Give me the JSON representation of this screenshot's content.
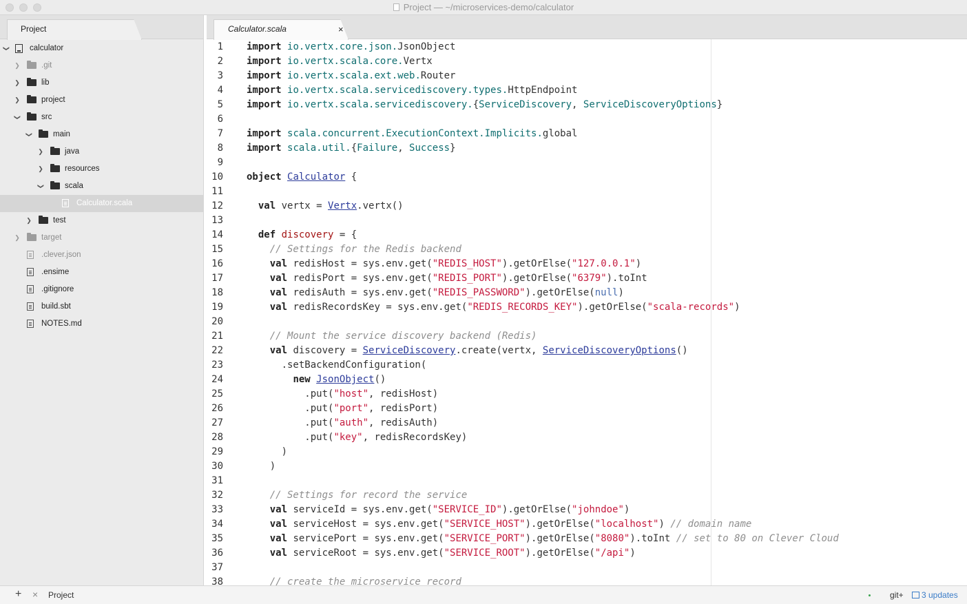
{
  "window": {
    "title": "Project — ~/microservices-demo/calculator"
  },
  "sidebar": {
    "tab_label": "Project",
    "tree": [
      {
        "label": "calculator",
        "type": "repo",
        "depth": 0,
        "chevron": "down",
        "dim": false
      },
      {
        "label": ".git",
        "type": "folder",
        "depth": 1,
        "chevron": "right",
        "dim": true
      },
      {
        "label": "lib",
        "type": "folder",
        "depth": 1,
        "chevron": "right",
        "dim": false
      },
      {
        "label": "project",
        "type": "folder",
        "depth": 1,
        "chevron": "right",
        "dim": false
      },
      {
        "label": "src",
        "type": "folder",
        "depth": 1,
        "chevron": "down",
        "dim": false
      },
      {
        "label": "main",
        "type": "folder",
        "depth": 2,
        "chevron": "down",
        "dim": false
      },
      {
        "label": "java",
        "type": "folder",
        "depth": 3,
        "chevron": "right",
        "dim": false
      },
      {
        "label": "resources",
        "type": "folder",
        "depth": 3,
        "chevron": "right",
        "dim": false
      },
      {
        "label": "scala",
        "type": "folder",
        "depth": 3,
        "chevron": "down",
        "dim": false
      },
      {
        "label": "Calculator.scala",
        "type": "file",
        "depth": 4,
        "chevron": "",
        "dim": false,
        "selected": true
      },
      {
        "label": "test",
        "type": "folder",
        "depth": 2,
        "chevron": "right",
        "dim": false
      },
      {
        "label": "target",
        "type": "folder",
        "depth": 1,
        "chevron": "right",
        "dim": true
      },
      {
        "label": ".clever.json",
        "type": "file",
        "depth": 1,
        "chevron": "",
        "dim": true
      },
      {
        "label": ".ensime",
        "type": "file",
        "depth": 1,
        "chevron": "",
        "dim": false
      },
      {
        "label": ".gitignore",
        "type": "file",
        "depth": 1,
        "chevron": "",
        "dim": false
      },
      {
        "label": "build.sbt",
        "type": "file",
        "depth": 1,
        "chevron": "",
        "dim": false
      },
      {
        "label": "NOTES.md",
        "type": "file",
        "depth": 1,
        "chevron": "",
        "dim": false
      }
    ]
  },
  "editor": {
    "tab_label": "Calculator.scala",
    "tab_close": "×",
    "lines": [
      [
        [
          "kw",
          "import"
        ],
        [
          "t",
          " "
        ],
        [
          "pkg",
          "io.vertx.core.json."
        ],
        [
          "t",
          "JsonObject"
        ]
      ],
      [
        [
          "kw",
          "import"
        ],
        [
          "t",
          " "
        ],
        [
          "pkg",
          "io.vertx.scala.core."
        ],
        [
          "t",
          "Vertx"
        ]
      ],
      [
        [
          "kw",
          "import"
        ],
        [
          "t",
          " "
        ],
        [
          "pkg",
          "io.vertx.scala.ext.web."
        ],
        [
          "t",
          "Router"
        ]
      ],
      [
        [
          "kw",
          "import"
        ],
        [
          "t",
          " "
        ],
        [
          "pkg",
          "io.vertx.scala.servicediscovery.types."
        ],
        [
          "t",
          "HttpEndpoint"
        ]
      ],
      [
        [
          "kw",
          "import"
        ],
        [
          "t",
          " "
        ],
        [
          "pkg",
          "io.vertx.scala.servicediscovery."
        ],
        [
          "t",
          "{"
        ],
        [
          "pkg",
          "ServiceDiscovery"
        ],
        [
          "t",
          ", "
        ],
        [
          "pkg",
          "ServiceDiscoveryOptions"
        ],
        [
          "t",
          "}"
        ]
      ],
      [],
      [
        [
          "kw",
          "import"
        ],
        [
          "t",
          " "
        ],
        [
          "pkg",
          "scala.concurrent.ExecutionContext.Implicits."
        ],
        [
          "t",
          "global"
        ]
      ],
      [
        [
          "kw",
          "import"
        ],
        [
          "t",
          " "
        ],
        [
          "pkg",
          "scala.util."
        ],
        [
          "t",
          "{"
        ],
        [
          "pkg",
          "Failure"
        ],
        [
          "t",
          ", "
        ],
        [
          "pkg",
          "Success"
        ],
        [
          "t",
          "}"
        ]
      ],
      [],
      [
        [
          "kw",
          "object"
        ],
        [
          "t",
          " "
        ],
        [
          "typ",
          "Calculator"
        ],
        [
          "t",
          " {"
        ]
      ],
      [],
      [
        [
          "t",
          "  "
        ],
        [
          "kw",
          "val"
        ],
        [
          "t",
          " vertx = "
        ],
        [
          "typ",
          "Vertx"
        ],
        [
          "t",
          ".vertx()"
        ]
      ],
      [],
      [
        [
          "t",
          "  "
        ],
        [
          "kw",
          "def"
        ],
        [
          "t",
          " "
        ],
        [
          "fn",
          "discovery"
        ],
        [
          "t",
          " = {"
        ]
      ],
      [
        [
          "t",
          "    "
        ],
        [
          "cmt",
          "// Settings for the Redis backend"
        ]
      ],
      [
        [
          "t",
          "    "
        ],
        [
          "kw",
          "val"
        ],
        [
          "t",
          " redisHost = sys.env.get("
        ],
        [
          "str",
          "\"REDIS_HOST\""
        ],
        [
          "t",
          ").getOrElse("
        ],
        [
          "str",
          "\"127.0.0.1\""
        ],
        [
          "t",
          ")"
        ]
      ],
      [
        [
          "t",
          "    "
        ],
        [
          "kw",
          "val"
        ],
        [
          "t",
          " redisPort = sys.env.get("
        ],
        [
          "str",
          "\"REDIS_PORT\""
        ],
        [
          "t",
          ").getOrElse("
        ],
        [
          "str",
          "\"6379\""
        ],
        [
          "t",
          ").toInt"
        ]
      ],
      [
        [
          "t",
          "    "
        ],
        [
          "kw",
          "val"
        ],
        [
          "t",
          " redisAuth = sys.env.get("
        ],
        [
          "str",
          "\"REDIS_PASSWORD\""
        ],
        [
          "t",
          ").getOrElse("
        ],
        [
          "nul",
          "null"
        ],
        [
          "t",
          ")"
        ]
      ],
      [
        [
          "t",
          "    "
        ],
        [
          "kw",
          "val"
        ],
        [
          "t",
          " redisRecordsKey = sys.env.get("
        ],
        [
          "str",
          "\"REDIS_RECORDS_KEY\""
        ],
        [
          "t",
          ").getOrElse("
        ],
        [
          "str",
          "\"scala-records\""
        ],
        [
          "t",
          ")"
        ]
      ],
      [],
      [
        [
          "t",
          "    "
        ],
        [
          "cmt",
          "// Mount the service discovery backend (Redis)"
        ]
      ],
      [
        [
          "t",
          "    "
        ],
        [
          "kw",
          "val"
        ],
        [
          "t",
          " discovery = "
        ],
        [
          "typ",
          "ServiceDiscovery"
        ],
        [
          "t",
          ".create(vertx, "
        ],
        [
          "typ",
          "ServiceDiscoveryOptions"
        ],
        [
          "t",
          "()"
        ]
      ],
      [
        [
          "t",
          "      .setBackendConfiguration("
        ]
      ],
      [
        [
          "t",
          "        "
        ],
        [
          "kw",
          "new"
        ],
        [
          "t",
          " "
        ],
        [
          "typ",
          "JsonObject"
        ],
        [
          "t",
          "()"
        ]
      ],
      [
        [
          "t",
          "          .put("
        ],
        [
          "str",
          "\"host\""
        ],
        [
          "t",
          ", redisHost)"
        ]
      ],
      [
        [
          "t",
          "          .put("
        ],
        [
          "str",
          "\"port\""
        ],
        [
          "t",
          ", redisPort)"
        ]
      ],
      [
        [
          "t",
          "          .put("
        ],
        [
          "str",
          "\"auth\""
        ],
        [
          "t",
          ", redisAuth)"
        ]
      ],
      [
        [
          "t",
          "          .put("
        ],
        [
          "str",
          "\"key\""
        ],
        [
          "t",
          ", redisRecordsKey)"
        ]
      ],
      [
        [
          "t",
          "      )"
        ]
      ],
      [
        [
          "t",
          "    )"
        ]
      ],
      [],
      [
        [
          "t",
          "    "
        ],
        [
          "cmt",
          "// Settings for record the service"
        ]
      ],
      [
        [
          "t",
          "    "
        ],
        [
          "kw",
          "val"
        ],
        [
          "t",
          " serviceId = sys.env.get("
        ],
        [
          "str",
          "\"SERVICE_ID\""
        ],
        [
          "t",
          ").getOrElse("
        ],
        [
          "str",
          "\"johndoe\""
        ],
        [
          "t",
          ")"
        ]
      ],
      [
        [
          "t",
          "    "
        ],
        [
          "kw",
          "val"
        ],
        [
          "t",
          " serviceHost = sys.env.get("
        ],
        [
          "str",
          "\"SERVICE_HOST\""
        ],
        [
          "t",
          ").getOrElse("
        ],
        [
          "str",
          "\"localhost\""
        ],
        [
          "t",
          ") "
        ],
        [
          "cmt",
          "// domain name"
        ]
      ],
      [
        [
          "t",
          "    "
        ],
        [
          "kw",
          "val"
        ],
        [
          "t",
          " servicePort = sys.env.get("
        ],
        [
          "str",
          "\"SERVICE_PORT\""
        ],
        [
          "t",
          ").getOrElse("
        ],
        [
          "str",
          "\"8080\""
        ],
        [
          "t",
          ").toInt "
        ],
        [
          "cmt",
          "// set to 80 on Clever Cloud"
        ]
      ],
      [
        [
          "t",
          "    "
        ],
        [
          "kw",
          "val"
        ],
        [
          "t",
          " serviceRoot = sys.env.get("
        ],
        [
          "str",
          "\"SERVICE_ROOT\""
        ],
        [
          "t",
          ").getOrElse("
        ],
        [
          "str",
          "\"/api\""
        ],
        [
          "t",
          ")"
        ]
      ],
      [],
      [
        [
          "t",
          "    "
        ],
        [
          "cmt",
          "// create the microservice record"
        ]
      ]
    ]
  },
  "statusbar": {
    "add_icon": "+",
    "close_icon": "×",
    "project_label": "Project",
    "git_label": "git+",
    "updates_label": "3 updates"
  },
  "colors": {
    "keyword": "#222222",
    "package": "#0f6e70",
    "string": "#c41a3e",
    "comment": "#8e8e8e",
    "type_link": "#2d3c9b",
    "updates_link": "#3a7cc8"
  }
}
